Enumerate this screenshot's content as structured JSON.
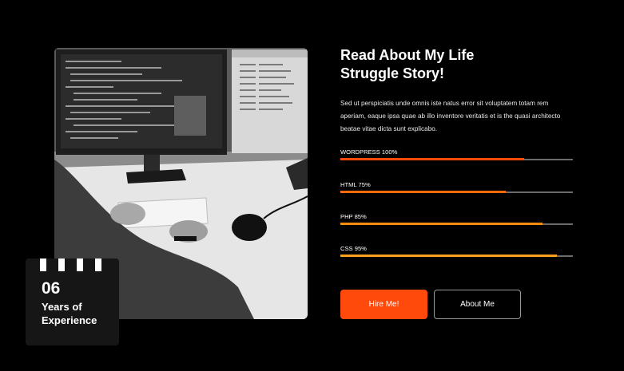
{
  "about": {
    "heading_line1": "Read About My Life",
    "heading_line2": "Struggle Story!",
    "description": "Sed ut perspiciatis unde omnis iste natus error sit voluptatem  totam rem aperiam, eaque ipsa quae ab illo inventore veritatis et is the quasi architecto beatae vitae dicta sunt explicabo."
  },
  "experience": {
    "number": "06",
    "label_line1": "Years of",
    "label_line2": "Experience"
  },
  "skills": [
    {
      "label": "WORDPRESS 100%",
      "level": 0.79,
      "color": "#ff4a0c"
    },
    {
      "label": "HTML 75%",
      "level": 0.71,
      "color": "#ff6a0a"
    },
    {
      "label": "PHP 85%",
      "level": 0.87,
      "color": "#ff8a10"
    },
    {
      "label": "CSS 95%",
      "level": 0.93,
      "color": "#ffa020"
    }
  ],
  "buttons": {
    "hire": "Hire Me!",
    "about": "About Me"
  },
  "image": {
    "alt": "person-coding-at-desk-photo"
  },
  "colors": {
    "accent": "#ff4a0c",
    "background": "#000000",
    "card": "#161616"
  }
}
